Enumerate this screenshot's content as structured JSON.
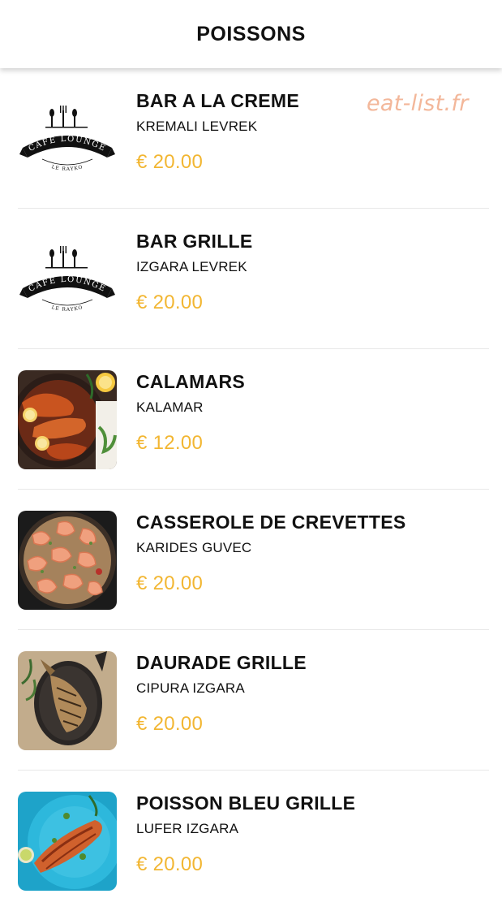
{
  "header": {
    "title": "POISSONS"
  },
  "watermark": "eat-list.fr",
  "logo": {
    "top_text": "CAFE LOUNGE",
    "bottom_text": "LE RAYKO"
  },
  "items": [
    {
      "name": "BAR A LA CREME",
      "subtitle": "KREMALI LEVREK",
      "price": "€ 20.00",
      "image": "cafe-lounge-logo"
    },
    {
      "name": "BAR GRILLE",
      "subtitle": "IZGARA LEVREK",
      "price": "€ 20.00",
      "image": "cafe-lounge-logo"
    },
    {
      "name": "CALAMARS",
      "subtitle": "KALAMAR",
      "price": "€ 12.00",
      "image": "calamari-photo"
    },
    {
      "name": "CASSEROLE DE CREVETTES",
      "subtitle": "KARIDES GUVEC",
      "price": "€ 20.00",
      "image": "shrimp-casserole-photo"
    },
    {
      "name": "DAURADE GRILLE",
      "subtitle": "CIPURA IZGARA",
      "price": "€ 20.00",
      "image": "grilled-sea-bream-photo"
    },
    {
      "name": "POISSON BLEU GRILLE",
      "subtitle": "LUFER IZGARA",
      "price": "€ 20.00",
      "image": "grilled-bluefish-photo"
    }
  ]
}
